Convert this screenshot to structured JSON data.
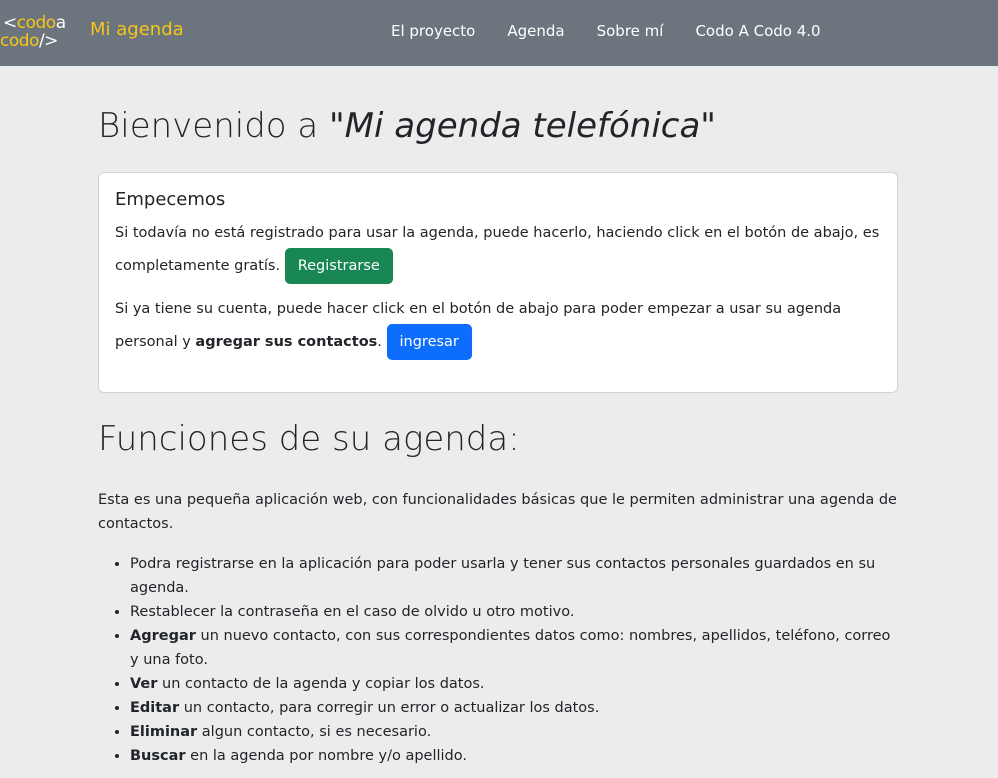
{
  "navbar": {
    "logo": {
      "line1_prefix": "<",
      "line1_word": "codo",
      "line1_suffix": "a",
      "line2_word": "codo",
      "line2_suffix": "/>"
    },
    "brand": "Mi agenda",
    "links": [
      "El proyecto",
      "Agenda",
      "Sobre mí",
      "Codo A Codo 4.0"
    ]
  },
  "welcome": {
    "prefix": "Bienvenido a ",
    "app_name": "\"Mi agenda telefónica\""
  },
  "card": {
    "title": "Empecemos",
    "p1_text": "Si todavía no está registrado para usar la agenda, puede hacerlo, haciendo click en el botón de abajo, es completamente gratís.",
    "register_button": "Registrarse",
    "p2_text": "Si ya tiene su cuenta, puede hacer click en el botón de abajo para poder empezar a usar su agenda personal y ",
    "p2_bold": "agregar sus contactos",
    "p2_end": ".",
    "login_button": "ingresar"
  },
  "functions": {
    "title": "Funciones de su agenda:",
    "intro": "Esta es una pequeña aplicación web, con funcionalidades básicas que le permiten administrar una agenda de contactos.",
    "items": [
      {
        "bold": "",
        "text": "Podra registrarse en la aplicación para poder usarla y tener sus contactos personales guardados en su agenda."
      },
      {
        "bold": "",
        "text": "Restablecer la contraseña en el caso de olvido u otro motivo."
      },
      {
        "bold": "Agregar",
        "text": " un nuevo contacto, con sus correspondientes datos como: nombres, apellidos, teléfono, correo y una foto."
      },
      {
        "bold": "Ver",
        "text": " un contacto de la agenda y copiar los datos."
      },
      {
        "bold": "Editar",
        "text": " un contacto, para corregir un error o actualizar los datos."
      },
      {
        "bold": "Eliminar",
        "text": " algun contacto, si es necesario."
      },
      {
        "bold": "Buscar",
        "text": " en la agenda por nombre y/o apellido."
      }
    ]
  },
  "colors": {
    "navbar_bg": "#6c757d",
    "brand_yellow": "#f5c518",
    "page_bg": "#ececec",
    "success": "#198754",
    "primary": "#0d6efd"
  }
}
